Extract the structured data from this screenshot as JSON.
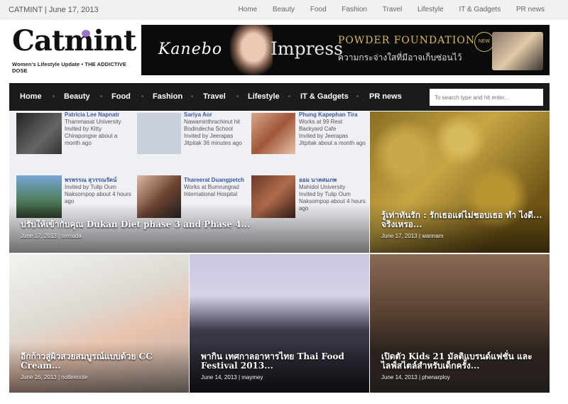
{
  "topbar": {
    "site_date": "CATMINT | June 17, 2013",
    "links": [
      "Home",
      "Beauty",
      "Food",
      "Fashion",
      "Travel",
      "Lifestyle",
      "IT & Gadgets",
      "PR news"
    ]
  },
  "logo": {
    "name": "Catmint",
    "tagline": "Women's Lifestyle Update • THE ADDICTIVE DOSE"
  },
  "banner": {
    "brand": "Kanebo",
    "product": "Impress",
    "headline": "POWDER FOUNDATION",
    "thai_text": "ความกระจ่างใสที่มีอาจเก็บซ่อนไว้",
    "badge": "NEW"
  },
  "nav": {
    "items": [
      "Home",
      "Beauty",
      "Food",
      "Fashion",
      "Travel",
      "Lifestyle",
      "IT & Gadgets",
      "PR news"
    ],
    "search_placeholder": "To search type and hit enter..."
  },
  "posts": [
    {
      "title": "ปรับให้เข้ากับคุณ Dukan Diet phase 3 and Phase 4...",
      "date": "June 17, 2013",
      "author": "sresuda"
    },
    {
      "title": "รู้เท่าทันรัก : รักเธอแต่ไม่ชอบเธอ ทำ ไงดี... จริงเหรอ...",
      "date": "June 17, 2013",
      "author": "wannam"
    },
    {
      "title": "อีกก้าวสู่ผิวสวยสมบูรณ์แบบด้วย CC Cream...",
      "date": "June 16, 2013",
      "author": "notleenote"
    },
    {
      "title": "พากิน เทศกาลอาหารไทย Thai Food Festival 2013...",
      "date": "June 14, 2013",
      "author": "maymey"
    },
    {
      "title": "เปิดตัว Kids 21 มัลติแบรนด์แฟชั่น และไลฟ์สไตล์สำหรับเด็กครั้ง...",
      "date": "June 14, 2013",
      "author": "phenarploy"
    }
  ],
  "fb_cards": [
    {
      "name": "Patricia Lee Napnatr",
      "lines": "Thammasat University",
      "invite": "Invited by Kitty Chirapongse about a month ago"
    },
    {
      "name": "Sariya Aor",
      "lines": "Nawaminthrachinut hit Bodindecha School",
      "invite": "Invited by Jeerapas Jitpitak 36 minutes ago"
    },
    {
      "name": "Phung Kapephan Tira",
      "lines": "Works at 99 Rest Backyard Cafe",
      "invite": "Invited by Jeerapas Jitpitak about a month ago"
    },
    {
      "name": "พรพรรณ สุวรรณรัตน์",
      "lines": "",
      "invite": "Invited by Tulip Oum Naksompop about 4 hours ago"
    },
    {
      "name": "Thareerat Duangpetch",
      "lines": "Works at Bumrungrad International Hospital",
      "invite": ""
    },
    {
      "name": "ออม นาคสมภพ",
      "lines": "Mahidol University",
      "invite": "Invited by Tulip Oum Naksompop about 4 hours ago"
    }
  ]
}
